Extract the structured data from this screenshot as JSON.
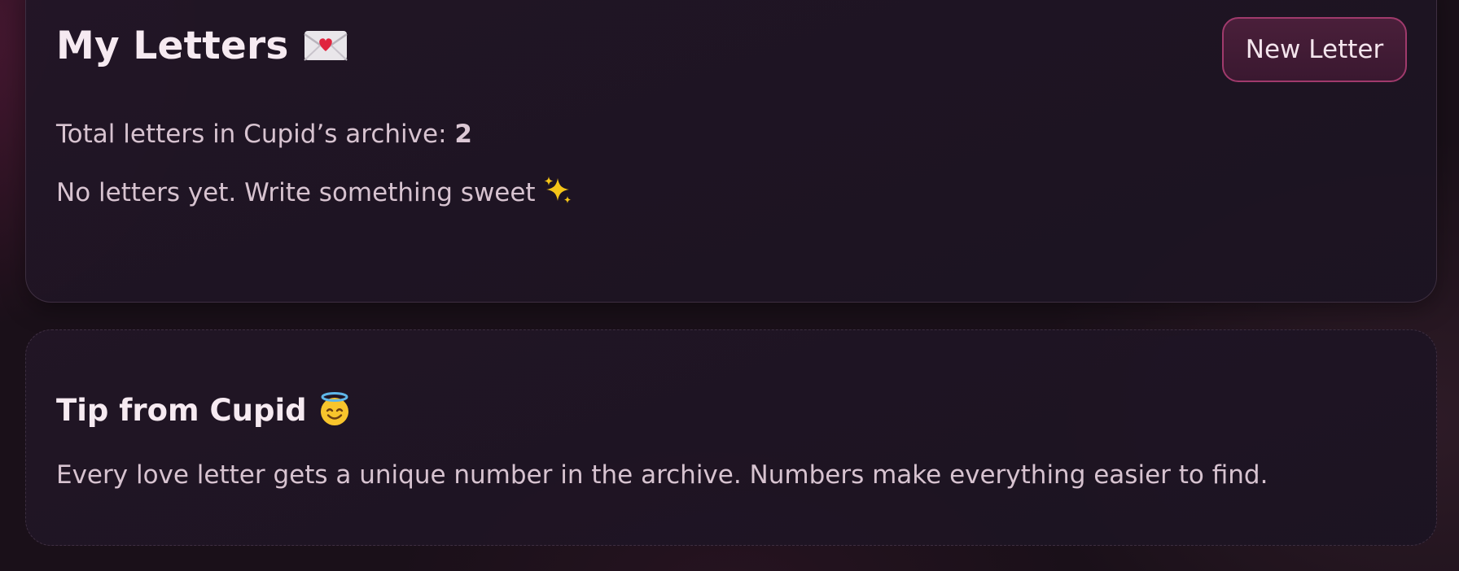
{
  "letters_card": {
    "title": "My Letters",
    "title_icon": "love-letter-envelope-icon",
    "new_letter_label": "New Letter",
    "total_label": "Total letters in Cupid’s archive: ",
    "total_count": "2",
    "empty_message": "No letters yet. Write something sweet",
    "empty_icon": "sparkles-icon"
  },
  "tip_card": {
    "title": "Tip from Cupid",
    "title_icon": "smiling-face-with-halo-icon",
    "text": "Every love letter gets a unique number in the archive. Numbers make everything easier to find."
  },
  "colors": {
    "background": "#1a1019",
    "card": "#221626",
    "accent_border": "#a03a6c",
    "button_fill": "#4a1f3a",
    "heading_text": "#f6eaf1",
    "body_text": "#d7c3d0"
  }
}
